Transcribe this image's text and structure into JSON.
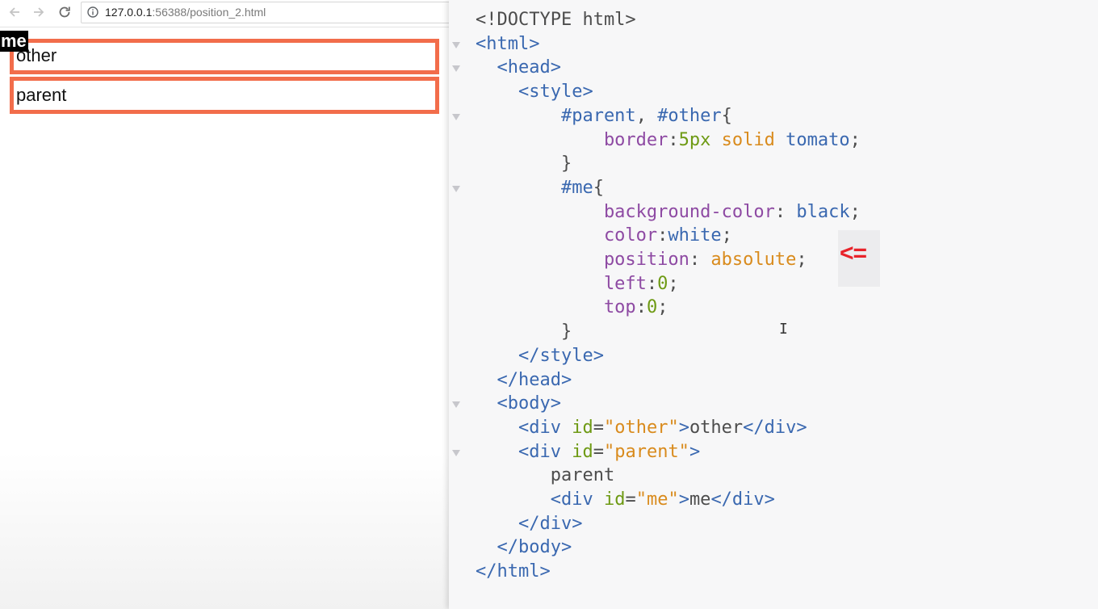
{
  "browser": {
    "url_host": "127.0.0.1",
    "url_rest": ":56388/position_2.html",
    "demo": {
      "other_text": "other",
      "parent_text": "parent",
      "me_text": "me"
    },
    "accent_color": "#f26d4b"
  },
  "editor": {
    "lines": [
      [
        {
          "c": "t-plain",
          "t": "<!DOCTYPE html>"
        }
      ],
      [
        {
          "c": "t-tag",
          "t": "<html>"
        }
      ],
      [
        {
          "c": "t-tag",
          "t": "  <head>"
        }
      ],
      [
        {
          "c": "t-tag",
          "t": "    <style>"
        }
      ],
      [
        {
          "c": "t-sel",
          "t": "        #parent"
        },
        {
          "c": "t-plain",
          "t": ", "
        },
        {
          "c": "t-sel",
          "t": "#other"
        },
        {
          "c": "t-plain",
          "t": "{"
        }
      ],
      [
        {
          "c": "t-prop",
          "t": "            border"
        },
        {
          "c": "t-plain",
          "t": ":"
        },
        {
          "c": "t-num",
          "t": "5px"
        },
        {
          "c": "t-plain",
          "t": " "
        },
        {
          "c": "t-kw",
          "t": "solid"
        },
        {
          "c": "t-plain",
          "t": " "
        },
        {
          "c": "t-val",
          "t": "tomato"
        },
        {
          "c": "t-plain",
          "t": ";"
        }
      ],
      [
        {
          "c": "t-plain",
          "t": "        }"
        }
      ],
      [
        {
          "c": "t-sel",
          "t": "        #me"
        },
        {
          "c": "t-plain",
          "t": "{"
        }
      ],
      [
        {
          "c": "t-prop",
          "t": "            background-color"
        },
        {
          "c": "t-plain",
          "t": ": "
        },
        {
          "c": "t-val",
          "t": "black"
        },
        {
          "c": "t-plain",
          "t": ";"
        }
      ],
      [
        {
          "c": "t-prop",
          "t": "            color"
        },
        {
          "c": "t-plain",
          "t": ":"
        },
        {
          "c": "t-val",
          "t": "white"
        },
        {
          "c": "t-plain",
          "t": ";"
        }
      ],
      [
        {
          "c": "t-prop",
          "t": "            position"
        },
        {
          "c": "t-plain",
          "t": ": "
        },
        {
          "c": "t-kw",
          "t": "absolute"
        },
        {
          "c": "t-plain",
          "t": ";"
        }
      ],
      [
        {
          "c": "t-prop",
          "t": "            left"
        },
        {
          "c": "t-plain",
          "t": ":"
        },
        {
          "c": "t-num",
          "t": "0"
        },
        {
          "c": "t-plain",
          "t": ";"
        }
      ],
      [
        {
          "c": "t-prop",
          "t": "            top"
        },
        {
          "c": "t-plain",
          "t": ":"
        },
        {
          "c": "t-num",
          "t": "0"
        },
        {
          "c": "t-plain",
          "t": ";"
        }
      ],
      [
        {
          "c": "t-plain",
          "t": "        }"
        }
      ],
      [
        {
          "c": "t-tag",
          "t": "    </style>"
        }
      ],
      [
        {
          "c": "t-tag",
          "t": "  </head>"
        }
      ],
      [
        {
          "c": "t-tag",
          "t": "  <body>"
        }
      ],
      [
        {
          "c": "t-tag",
          "t": "    <div "
        },
        {
          "c": "t-attr",
          "t": "id"
        },
        {
          "c": "t-plain",
          "t": "="
        },
        {
          "c": "t-str",
          "t": "\"other\""
        },
        {
          "c": "t-tag",
          "t": ">"
        },
        {
          "c": "t-plain",
          "t": "other"
        },
        {
          "c": "t-tag",
          "t": "</div>"
        }
      ],
      [
        {
          "c": "t-tag",
          "t": "    <div "
        },
        {
          "c": "t-attr",
          "t": "id"
        },
        {
          "c": "t-plain",
          "t": "="
        },
        {
          "c": "t-str",
          "t": "\"parent\""
        },
        {
          "c": "t-tag",
          "t": ">"
        }
      ],
      [
        {
          "c": "t-plain",
          "t": "       parent"
        }
      ],
      [
        {
          "c": "t-tag",
          "t": "       <div "
        },
        {
          "c": "t-attr",
          "t": "id"
        },
        {
          "c": "t-plain",
          "t": "="
        },
        {
          "c": "t-str",
          "t": "\"me\""
        },
        {
          "c": "t-tag",
          "t": ">"
        },
        {
          "c": "t-plain",
          "t": "me"
        },
        {
          "c": "t-tag",
          "t": "</div>"
        }
      ],
      [
        {
          "c": "t-tag",
          "t": "    </div>"
        }
      ],
      [
        {
          "c": "t-tag",
          "t": "  </body>"
        }
      ],
      [
        {
          "c": "t-tag",
          "t": "</html>"
        }
      ]
    ],
    "fold_marker_lines": [
      1,
      2,
      4,
      7,
      16,
      18
    ],
    "highlight_marker": "<="
  }
}
